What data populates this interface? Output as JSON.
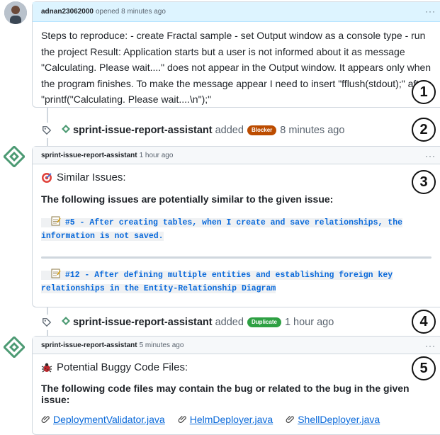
{
  "issue_comment": {
    "author": "adnan23062000",
    "meta": "opened 8 minutes ago",
    "body": "Steps to reproduce: - create Fractal sample - set Output window as a console type - run the project Result: Application starts but a user is not informed about it as message \"Calculating. Please wait....\" does not appear in the Output window. It appears only when the program finishes. To make the message appear I need to insert \"fflush(stdout);\" after \"printf(\"Calculating. Please wait....\\n\");\""
  },
  "event1": {
    "actor": "sprint-issue-report-assistant",
    "verb": "added",
    "label": "Blocker",
    "label_color": "#bc4c00",
    "time": "8 minutes ago"
  },
  "comment2": {
    "author": "sprint-issue-report-assistant",
    "meta": "1 hour ago",
    "title_icon": "target-icon",
    "title": "Similar Issues:",
    "description": "The following issues are potentially similar to the given issue:",
    "items": [
      "#5 - After creating tables, when I create and save relationships, the information is not saved.",
      "#12 - After defining multiple entities and establishing foreign key relationships in the Entity-Relationship Diagram"
    ]
  },
  "event2": {
    "actor": "sprint-issue-report-assistant",
    "verb": "added",
    "label": "Duplicate",
    "label_color": "#2ea043",
    "time": "1 hour ago"
  },
  "comment3": {
    "author": "sprint-issue-report-assistant",
    "meta": "5 minutes ago",
    "title_icon": "bug-icon",
    "title": "Potential Buggy Code Files:",
    "description": "The following code files may contain the bug or related to the bug in the given issue:",
    "files": [
      "DeploymentValidator.java",
      "HelmDeployer.java",
      "ShellDeployer.java"
    ]
  },
  "markers": [
    "1",
    "2",
    "3",
    "4",
    "5"
  ],
  "colors": {
    "link": "#0969da",
    "header_blue": "#ddf4ff",
    "border": "#d0d7de"
  }
}
